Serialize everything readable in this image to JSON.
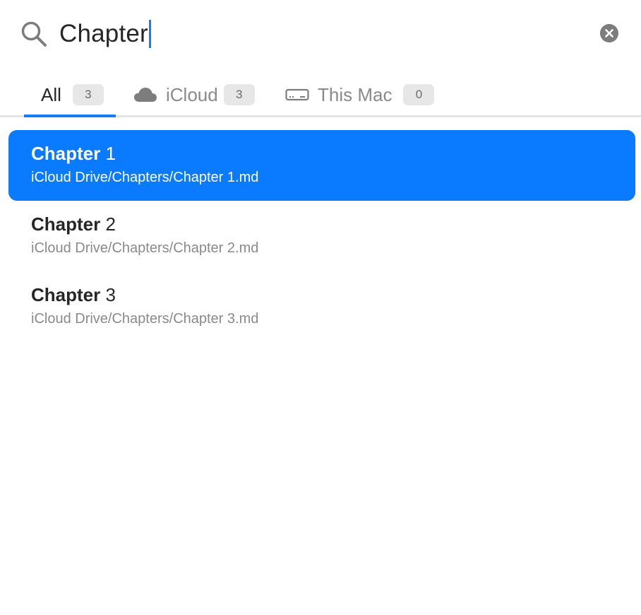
{
  "search": {
    "query": "Chapter"
  },
  "tabs": [
    {
      "label": "All",
      "count": "3",
      "icon": "",
      "active": true
    },
    {
      "label": "iCloud",
      "count": "3",
      "icon": "cloud-icon",
      "active": false
    },
    {
      "label": "This Mac",
      "count": "0",
      "icon": "drive-icon",
      "active": false
    }
  ],
  "results": [
    {
      "title_match": "Chapter",
      "title_rest": " 1",
      "path": "iCloud Drive/Chapters/Chapter 1.md",
      "selected": true
    },
    {
      "title_match": "Chapter",
      "title_rest": " 2",
      "path": "iCloud Drive/Chapters/Chapter 2.md",
      "selected": false
    },
    {
      "title_match": "Chapter",
      "title_rest": " 3",
      "path": "iCloud Drive/Chapters/Chapter 3.md",
      "selected": false
    }
  ],
  "colors": {
    "accent": "#0a7aff",
    "caret": "#1a7cf5",
    "badge_bg": "#e7e7e7"
  }
}
